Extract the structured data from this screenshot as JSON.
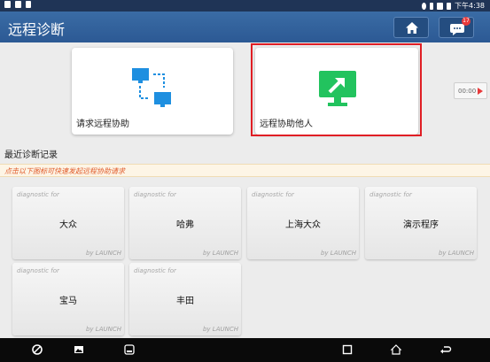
{
  "status_bar": {
    "time": "下午4:38"
  },
  "app_bar": {
    "title": "远程诊断",
    "notification_count": "17"
  },
  "cards": [
    {
      "label": "请求远程协助"
    },
    {
      "label": "远程协助他人"
    }
  ],
  "timer": {
    "text": "00:00"
  },
  "recent": {
    "title": "最近诊断记录",
    "hint": "点击以下图标可快速发起远程协助请求",
    "tiles": [
      {
        "tag": "diagnostic for",
        "name": "大众",
        "by": "by LAUNCH"
      },
      {
        "tag": "diagnostic for",
        "name": "哈弗",
        "by": "by LAUNCH"
      },
      {
        "tag": "diagnostic for",
        "name": "上海大众",
        "by": "by LAUNCH"
      },
      {
        "tag": "diagnostic for",
        "name": "演示程序",
        "by": "by LAUNCH"
      },
      {
        "tag": "diagnostic for",
        "name": "宝马",
        "by": "by LAUNCH"
      },
      {
        "tag": "diagnostic for",
        "name": "丰田",
        "by": "by LAUNCH"
      }
    ]
  },
  "colors": {
    "accent": "#2c5994",
    "selection": "#e01e24",
    "hint": "#e05a2a",
    "green": "#22c35e",
    "blue": "#1e8fe0"
  }
}
